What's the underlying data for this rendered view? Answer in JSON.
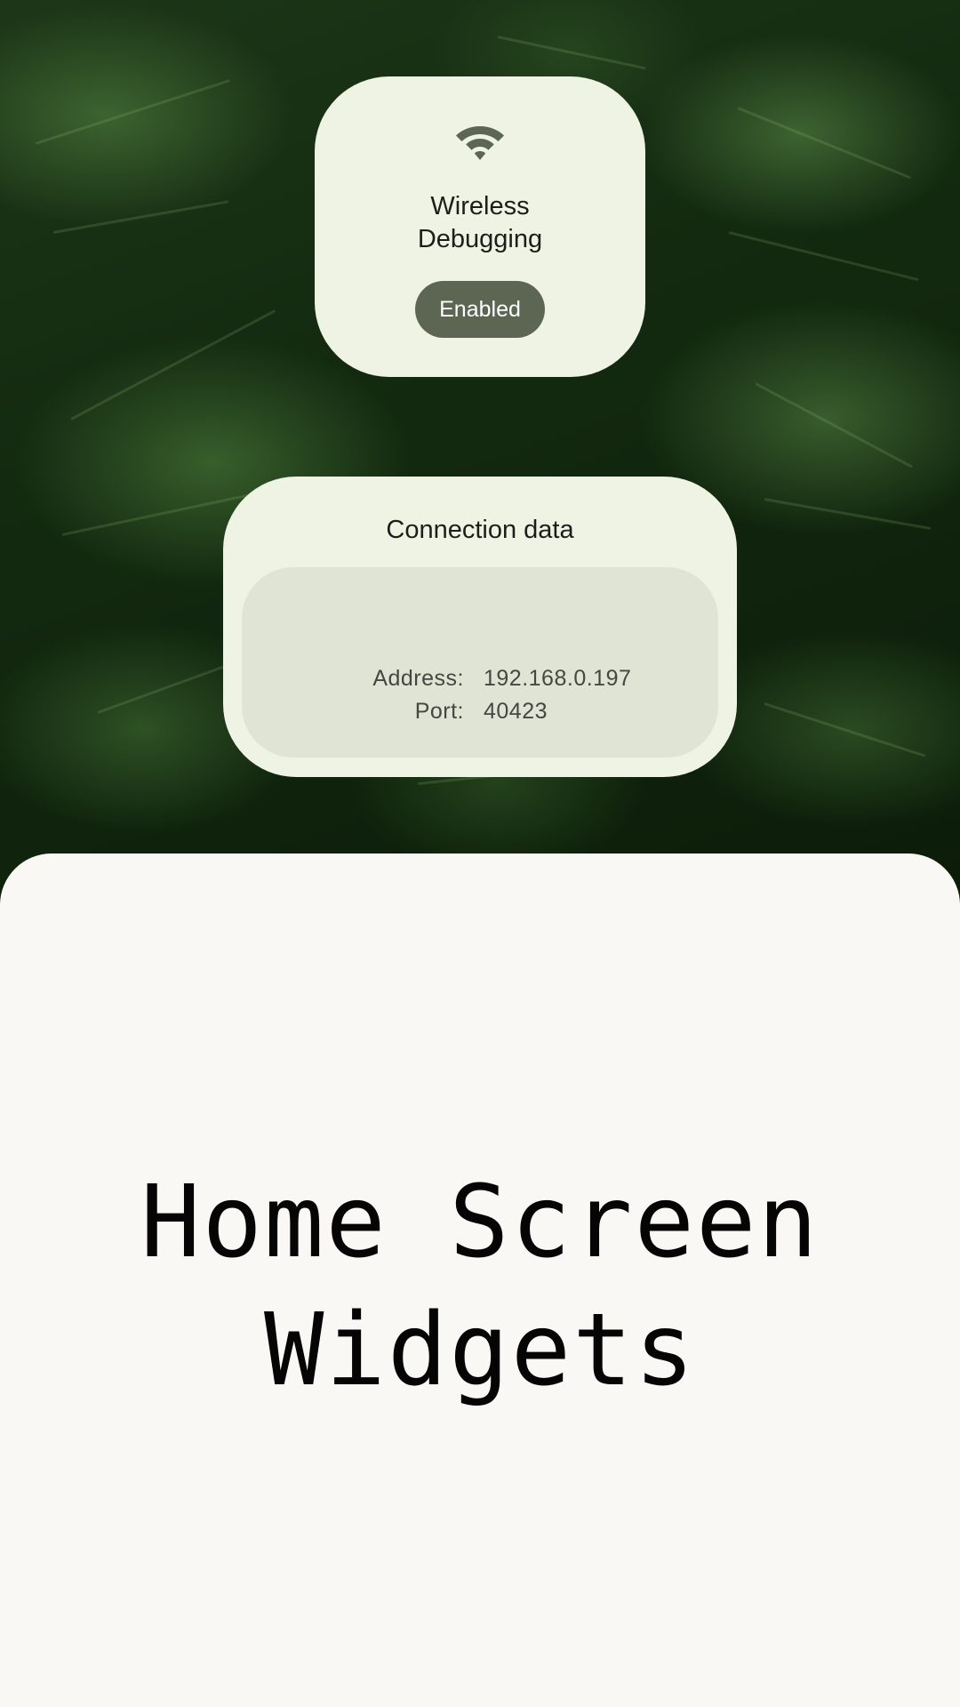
{
  "wireless_debugging_widget": {
    "icon": "wifi-icon",
    "title_line1": "Wireless",
    "title_line2": "Debugging",
    "status": "Enabled",
    "colors": {
      "card": "#eef3e3",
      "pill": "#5d6553",
      "icon": "#5d6553"
    }
  },
  "connection_data_widget": {
    "title": "Connection data",
    "rows": [
      {
        "label": "Address:",
        "value": "192.168.0.197"
      },
      {
        "label": "Port:",
        "value": "40423"
      }
    ],
    "colors": {
      "card": "#eef3e3",
      "inner": "#dfe4d5"
    }
  },
  "headline": {
    "line1": "Home Screen",
    "line2": "Widgets"
  }
}
